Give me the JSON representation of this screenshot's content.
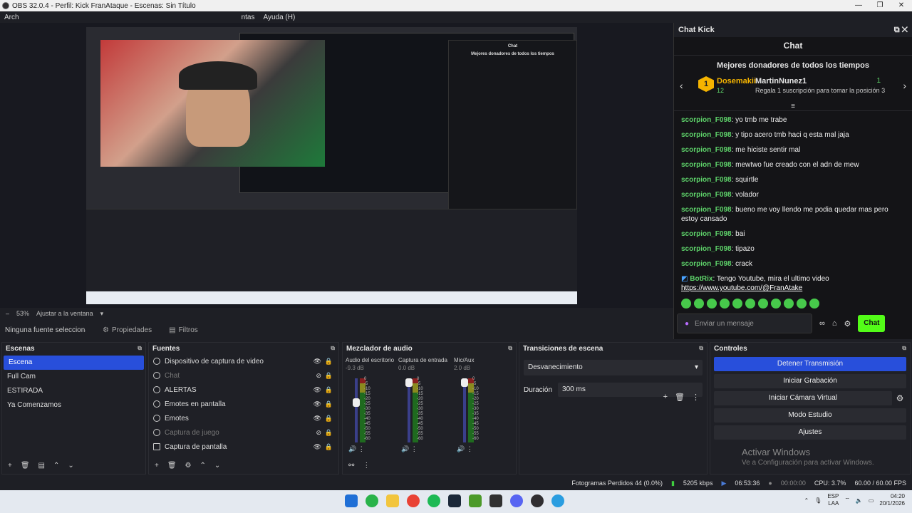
{
  "window": {
    "title": "OBS 32.0.4 - Perfil: Kick FranAtaque - Escenas: Sin Título"
  },
  "menu": {
    "items": [
      "Arch",
      "ntas",
      "Ayuda (H)"
    ]
  },
  "zoom": {
    "percent": "53%",
    "mode": "Ajustar a la ventana"
  },
  "source_toolbar": {
    "current": "Ninguna fuente seleccionac",
    "properties": "Propiedades",
    "filters": "Filtros"
  },
  "chat_dock": {
    "title": "Chat Kick",
    "header": "Chat",
    "donors_title": "Mejores donadores de todos los tiempos",
    "donor1": {
      "rank": "1",
      "name": "Dosemakii",
      "count": "12"
    },
    "donor2": {
      "name": "MartinNunez1",
      "sub": "Regala 1 suscripción para tomar la posición 3",
      "badge": "1"
    },
    "messages": [
      {
        "user": "scorpion_F098",
        "text": ": yo tmb me trabe"
      },
      {
        "user": "scorpion_F098",
        "text": ": y tipo acero tmb haci q esta mal jaja"
      },
      {
        "user": "scorpion_F098",
        "text": ": me hiciste sentir mal"
      },
      {
        "user": "scorpion_F098",
        "text": ": mewtwo fue creado con el adn de mew"
      },
      {
        "user": "scorpion_F098",
        "text": ": squirtle"
      },
      {
        "user": "scorpion_F098",
        "text": ": volador"
      },
      {
        "user": "scorpion_F098",
        "text": ": bueno me voy llendo me podia quedar mas pero estoy cansado"
      },
      {
        "user": "scorpion_F098",
        "text": ": bai"
      },
      {
        "user": "scorpion_F098",
        "text": ": tipazo"
      },
      {
        "user": "scorpion_F098",
        "text": ": crack"
      }
    ],
    "bot": {
      "user": "BotRix",
      "text": ": Tengo Youtube, mira el ultimo video",
      "link": "https://www.youtube.com/@FranAtake"
    },
    "input_placeholder": "Enviar un mensaje",
    "send": "Chat",
    "accent": "#53fc18"
  },
  "docks": {
    "scenes": {
      "title": "Escenas",
      "items": [
        "Escena",
        "Full Cam",
        "ESTIRADA",
        "Ya Comenzamos"
      ]
    },
    "sources": {
      "title": "Fuentes",
      "items": [
        "Dispositivo de captura de video",
        "Chat",
        "ALERTAS",
        "Emotes en pantalla",
        "Emotes",
        "Captura de juego",
        "Captura de pantalla"
      ]
    },
    "mixer": {
      "title": "Mezclador de audio",
      "channels": [
        {
          "name": "Audio del escritorio",
          "db": "-9.3 dB"
        },
        {
          "name": "Captura de entrada",
          "db": "0.0 dB"
        },
        {
          "name": "Mic/Aux",
          "db": "2.0 dB"
        }
      ],
      "ticks": [
        "0",
        "-5",
        "-10",
        "-15",
        "-20",
        "-25",
        "-30",
        "-35",
        "-40",
        "-45",
        "-50",
        "-55",
        "-60"
      ]
    },
    "transitions": {
      "title": "Transiciones de escena",
      "selected": "Desvanecimiento",
      "duration_label": "Duración",
      "duration": "300 ms"
    },
    "controls": {
      "title": "Controles",
      "buttons": [
        "Detener Transmisión",
        "Iniciar Grabación",
        "Iniciar Cámara Virtual",
        "Modo Estudio",
        "Ajustes"
      ],
      "watermark": "Activar Windows",
      "watermark_sub": "Ve a Configuración para activar Windows."
    }
  },
  "status": {
    "dropped": "Fotogramas Perdidos 44 (0.0%)",
    "kbps": "5205 kbps",
    "live": "06:53:36",
    "rec": "00:00:00",
    "cpu": "CPU: 3.7%",
    "fps": "60.00 / 60.00 FPS"
  },
  "taskbar": {
    "lang": "ESP",
    "lang2": "LAA",
    "time": "04:20",
    "date": "20/1/2026"
  }
}
